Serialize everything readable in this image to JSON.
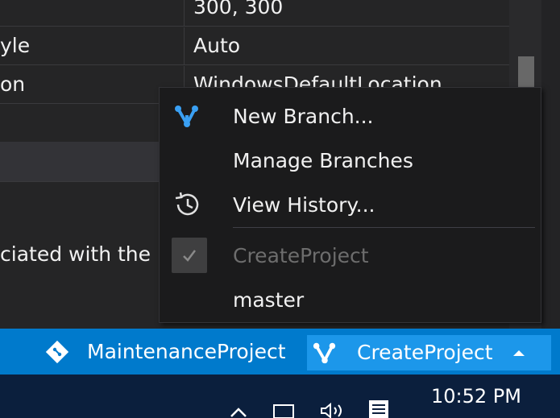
{
  "properties": {
    "rows": [
      {
        "name": "",
        "value": "300, 300"
      },
      {
        "name": "yle",
        "value": "Auto"
      },
      {
        "name": "on",
        "value": "WindowsDefaultLocation"
      }
    ],
    "description_text": "ciated with the"
  },
  "context_menu": {
    "items": [
      {
        "label": "New Branch...",
        "icon": "branch-icon"
      },
      {
        "label": "Manage Branches",
        "icon": ""
      },
      {
        "label": "View History...",
        "icon": "history-icon"
      },
      {
        "label": "CreateProject",
        "icon": "checkmark-icon",
        "checked": true,
        "disabled": true
      },
      {
        "label": "master",
        "icon": ""
      }
    ]
  },
  "status_bar": {
    "repo_label": "MaintenanceProject",
    "branch_label": "CreateProject",
    "colors": {
      "background": "#007acc",
      "branch_bg": "#1c97ea"
    }
  },
  "taskbar": {
    "clock": "10:52 PM"
  },
  "colors": {
    "accent": "#3aa0f3",
    "menu_bg": "#1b1b1c"
  }
}
